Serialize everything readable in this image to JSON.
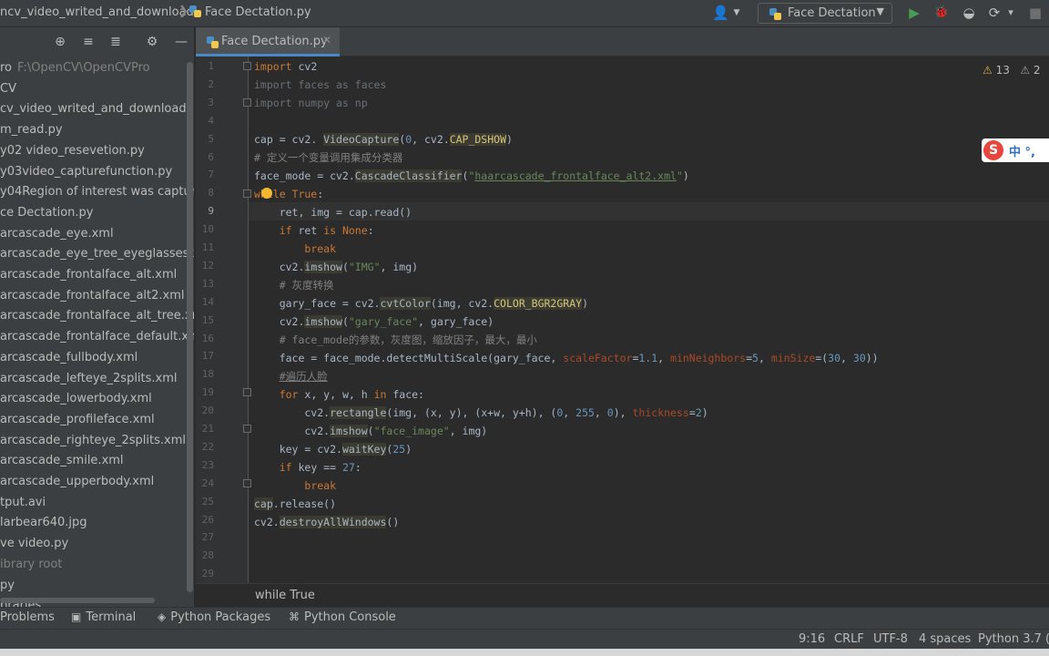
{
  "topbar": {
    "crumb_project": "ncv_video_writed_and_download",
    "crumb_file": "Face Dectation.py",
    "run_config": "Face Dectation"
  },
  "icons": {
    "separator": "❯",
    "user": "👤",
    "dropdown": "▼",
    "run": "▶",
    "debug": "🐞",
    "coverage": "◒",
    "profile": "⟳",
    "more": "▾",
    "stop": "■",
    "locate": "⊕",
    "expand": "≡",
    "collapse": "≣",
    "gear": "⚙",
    "minimize": "—",
    "close": "✕",
    "warning": "⚠",
    "terminal": "▣",
    "packages": "◈",
    "console": "⌘",
    "problems": "◉"
  },
  "colors": {
    "run": "#499c54",
    "debug": "#59a869",
    "stop": "#6e6e6e",
    "accent": "#4a88c7"
  },
  "project_tree": [
    {
      "label": "ro",
      "sub": "F:\\OpenCV\\OpenCVPro"
    },
    {
      "label": "CV"
    },
    {
      "label": "cv_video_writed_and_download"
    },
    {
      "label": "m_read.py"
    },
    {
      "label": "y02 video_resevetion.py"
    },
    {
      "label": "y03video_capturefunction.py"
    },
    {
      "label": "y04Region of interest was captured.p"
    },
    {
      "label": "ce Dectation.py"
    },
    {
      "label": "arcascade_eye.xml"
    },
    {
      "label": "arcascade_eye_tree_eyeglasses.xml"
    },
    {
      "label": "arcascade_frontalface_alt.xml"
    },
    {
      "label": "arcascade_frontalface_alt2.xml"
    },
    {
      "label": "arcascade_frontalface_alt_tree.xml"
    },
    {
      "label": "arcascade_frontalface_default.xml"
    },
    {
      "label": "arcascade_fullbody.xml"
    },
    {
      "label": "arcascade_lefteye_2splits.xml"
    },
    {
      "label": "arcascade_lowerbody.xml"
    },
    {
      "label": "arcascade_profileface.xml"
    },
    {
      "label": "arcascade_righteye_2splits.xml"
    },
    {
      "label": "arcascade_smile.xml"
    },
    {
      "label": "arcascade_upperbody.xml"
    },
    {
      "label": "tput.avi"
    },
    {
      "label": "larbear640.jpg"
    },
    {
      "label": "ve video.py"
    },
    {
      "label": "ibrary root",
      "dim": true
    },
    {
      "label": "py"
    },
    {
      "label": "braries"
    }
  ],
  "editor": {
    "tab_label": "Face Dectation.py",
    "warnings_count": "13",
    "weak_warnings_count": "2",
    "ime_text": "中 °,",
    "ime_logo": "S",
    "breadcrumb": "while True",
    "current_line": 9,
    "line_numbers": [
      "1",
      "2",
      "3",
      "4",
      "5",
      "6",
      "7",
      "8",
      "9",
      "10",
      "11",
      "12",
      "13",
      "14",
      "15",
      "16",
      "17",
      "18",
      "19",
      "20",
      "21",
      "22",
      "23",
      "24",
      "25",
      "26",
      "27",
      "28",
      "29"
    ]
  },
  "tool_tabs": {
    "problems": "Problems",
    "terminal": "Terminal",
    "packages": "Python Packages",
    "console": "Python Console"
  },
  "status": {
    "position": "9:16",
    "line_sep": "CRLF",
    "encoding": "UTF-8",
    "indent": "4 spaces",
    "interpreter": "Python 3.7 (C"
  }
}
